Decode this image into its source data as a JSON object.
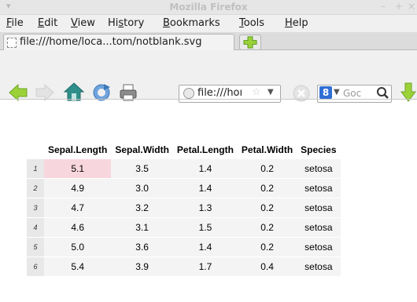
{
  "window": {
    "title": "Mozilla Firefox",
    "minimize": "–",
    "maximize": "+",
    "close": "×"
  },
  "menubar": {
    "items": [
      {
        "label": "File",
        "mnemonic": "F",
        "rest": "ile"
      },
      {
        "label": "Edit",
        "mnemonic": "E",
        "rest": "dit"
      },
      {
        "label": "View",
        "mnemonic": "V",
        "rest": "iew"
      },
      {
        "label": "History",
        "pre": "Hi",
        "mnemonic": "s",
        "rest": "tory"
      },
      {
        "label": "Bookmarks",
        "mnemonic": "B",
        "rest": "ookmarks"
      },
      {
        "label": "Tools",
        "mnemonic": "T",
        "rest": "ools"
      },
      {
        "label": "Help",
        "mnemonic": "H",
        "rest": "elp"
      }
    ]
  },
  "tabs": [
    {
      "label": "file:///home/loca...tom/notblank.svg"
    }
  ],
  "navbar": {
    "url": "file:///hoı",
    "search_engine_letter": "8",
    "search_placeholder": "Goc"
  },
  "icons": {
    "back": "back-arrow-icon",
    "forward": "forward-arrow-icon",
    "home": "home-icon",
    "reload": "reload-icon",
    "print": "print-icon",
    "stop": "stop-icon",
    "download": "download-arrow-icon",
    "new_tab": "plus-icon"
  },
  "colors": {
    "highlight_cell": "#f8d6de",
    "toolbar_green": "#9bd23a",
    "home_teal": "#2f8e8a",
    "reload_blue": "#5a92cf"
  },
  "table": {
    "headers": [
      "Sepal.Length",
      "Sepal.Width",
      "Petal.Length",
      "Petal.Width",
      "Species"
    ],
    "rows": [
      {
        "id": "1",
        "cells": [
          "5.1",
          "3.5",
          "1.4",
          "0.2",
          "setosa"
        ]
      },
      {
        "id": "2",
        "cells": [
          "4.9",
          "3.0",
          "1.4",
          "0.2",
          "setosa"
        ]
      },
      {
        "id": "3",
        "cells": [
          "4.7",
          "3.2",
          "1.3",
          "0.2",
          "setosa"
        ]
      },
      {
        "id": "4",
        "cells": [
          "4.6",
          "3.1",
          "1.5",
          "0.2",
          "setosa"
        ]
      },
      {
        "id": "5",
        "cells": [
          "5.0",
          "3.6",
          "1.4",
          "0.2",
          "setosa"
        ]
      },
      {
        "id": "6",
        "cells": [
          "5.4",
          "3.9",
          "1.7",
          "0.4",
          "setosa"
        ]
      }
    ],
    "highlighted": {
      "row": 0,
      "col": 0
    }
  }
}
